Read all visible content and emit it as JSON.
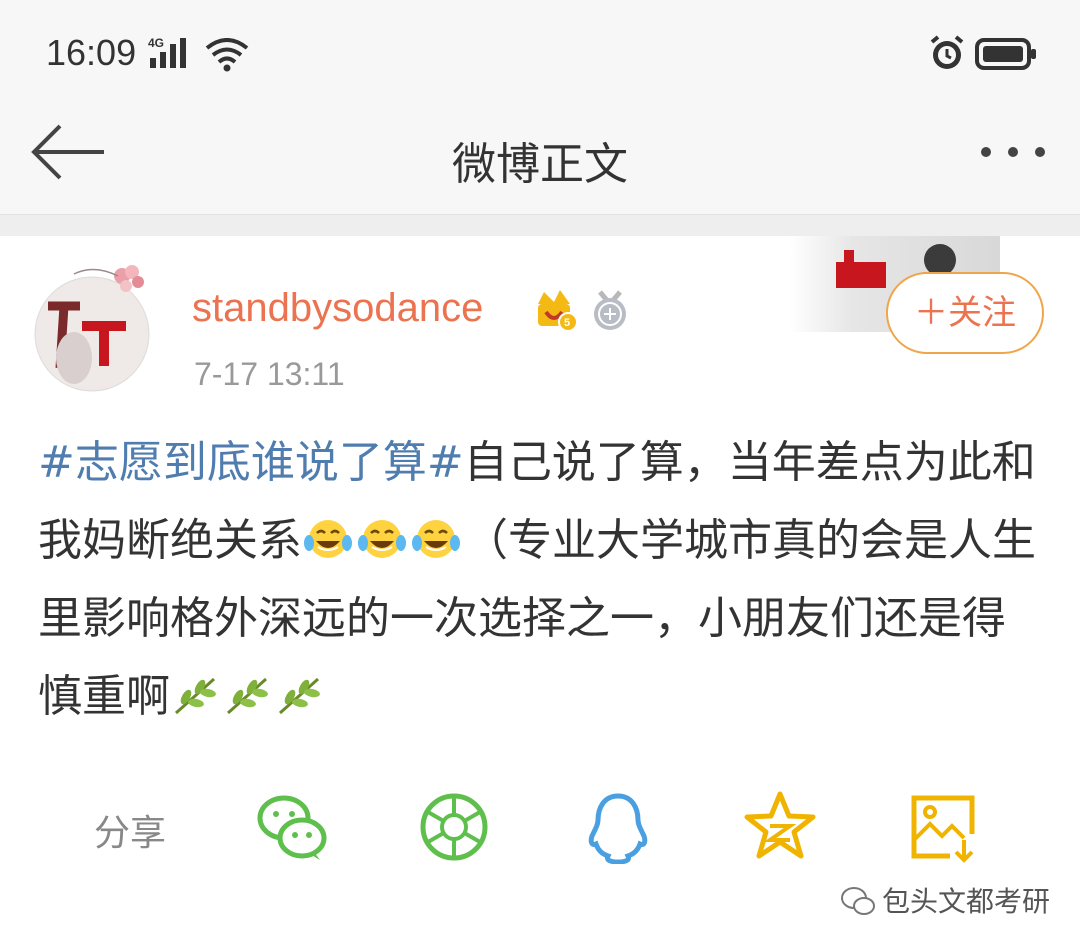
{
  "status_bar": {
    "time": "16:09",
    "network": "4G",
    "icons": [
      "signal-icon",
      "wifi-icon",
      "alarm-icon",
      "battery-icon"
    ]
  },
  "nav": {
    "title": "微博正文",
    "icons": [
      "back-arrow-icon",
      "more-icon"
    ]
  },
  "post": {
    "username": "standbysodance",
    "date": "7-17 13:11",
    "follow_label": "＋关注",
    "topic": "#志愿到底谁说了算#",
    "text_a": "自己说了算，当年差点为此和我妈断绝关系",
    "text_b": "（专业大学城市真的会是人生里影响格外深远的一次选择之一，小朋友们还是得慎重啊",
    "badges": [
      "crown-badge-icon",
      "medal-badge-icon"
    ],
    "emojis": [
      "laugh-cry-emoji",
      "laugh-cry-emoji",
      "laugh-cry-emoji",
      "olive-branch-emoji",
      "olive-branch-emoji",
      "olive-branch-emoji"
    ]
  },
  "share": {
    "label": "分享",
    "targets": [
      "wechat-icon",
      "moments-icon",
      "qq-icon",
      "qzone-icon",
      "save-image-icon"
    ]
  },
  "watermark": {
    "text": "包头文都考研"
  },
  "colors": {
    "username": "#eb7350",
    "topic": "#507daf",
    "follow_border": "#f0a54a",
    "share_green": "#5fbf4c",
    "share_blue": "#4a9fe0",
    "share_yellow": "#f0b400"
  }
}
